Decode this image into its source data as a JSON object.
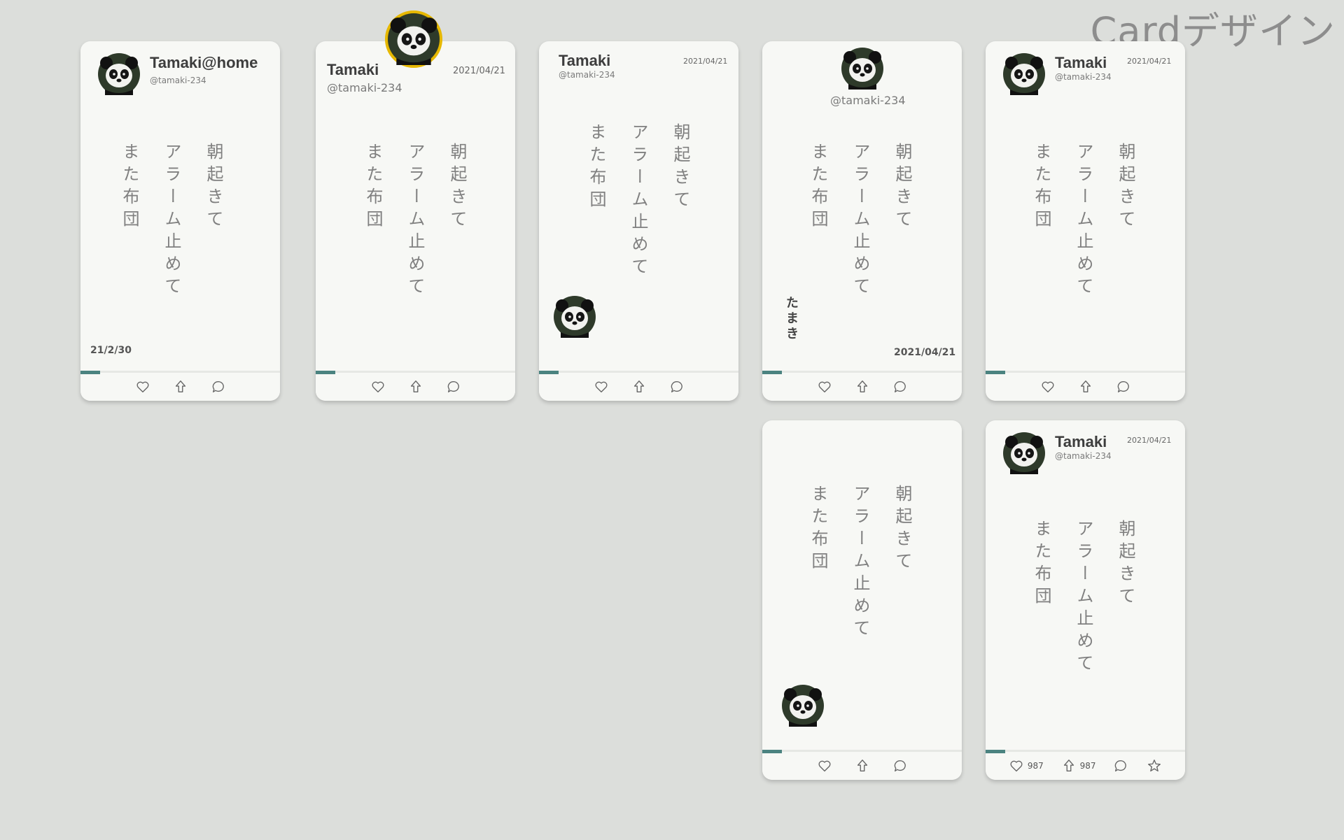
{
  "page": {
    "title": "Cardデザイン"
  },
  "user": {
    "name": "Tamaki",
    "name_home": "Tamaki@home",
    "handle": "@tamaki-234",
    "signature": "たまき"
  },
  "poem": {
    "line1": "朝起きて",
    "line2": "アラーム止めて",
    "line3": "また布団"
  },
  "dates": {
    "full": "2021/04/21",
    "short": "21/2/30"
  },
  "counts": {
    "likes": "987",
    "shares": "987"
  },
  "colors": {
    "background": "#dcdedb",
    "card": "#f7f8f5",
    "accent": "#4b8380",
    "avatar_ring": "#e6b800"
  },
  "icons": {
    "like": "heart-icon",
    "share": "share-arrow-icon",
    "comment": "comment-icon",
    "favorite": "star-icon"
  }
}
